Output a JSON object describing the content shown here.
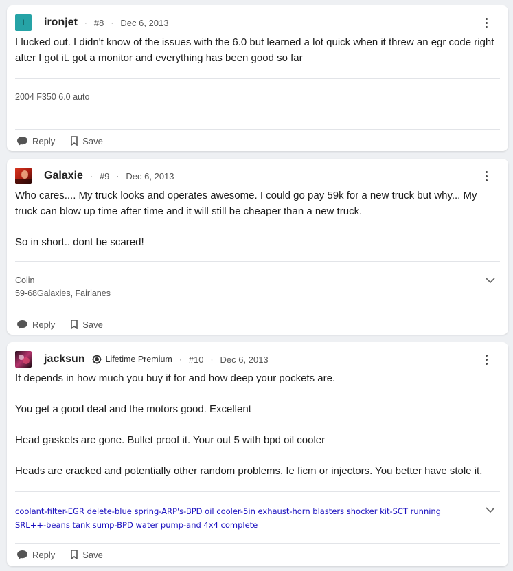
{
  "posts": [
    {
      "avatar_letter": "I",
      "avatar_color": "#26a3a6",
      "username": "ironjet",
      "badge": "",
      "number": "#8",
      "date": "Dec 6, 2013",
      "body": [
        "I lucked out. I didn't know of the issues with the 6.0 but learned a lot quick when it threw an egr code right after I got it. got a monitor and everything has been good so far"
      ],
      "signature": [
        "2004 F350 6.0 auto"
      ],
      "reply_label": "Reply",
      "save_label": "Save"
    },
    {
      "avatar_letter": "",
      "username": "Galaxie",
      "badge": "",
      "number": "#9",
      "date": "Dec 6, 2013",
      "body": [
        "Who cares.... My truck looks and operates awesome. I could go pay 59k for a new truck but why... My truck can blow up time after time and it will still be cheaper than a new truck.",
        "So in short.. dont be scared!"
      ],
      "signature": [
        "Colin",
        "59-68Galaxies, Fairlanes"
      ],
      "reply_label": "Reply",
      "save_label": "Save"
    },
    {
      "avatar_letter": "",
      "username": "jacksun",
      "badge": "Lifetime Premium",
      "number": "#10",
      "date": "Dec 6, 2013",
      "body": [
        "It depends in how much you buy it for and how deep your pockets are.",
        "You get a good deal and the motors good. Excellent",
        "Head gaskets are gone. Bullet proof it. Your out 5 with bpd oil cooler",
        "Heads are cracked and potentially other random problems. Ie ficm or injectors. You better have stole it."
      ],
      "signature": [
        "coolant-filter-EGR delete-blue spring-ARP's-BPD oil cooler-5in exhaust-horn blasters shocker kit-SCT running",
        "SRL++-beans tank sump-BPD water pump-and 4x4 complete"
      ],
      "signature_color": "#1a0fbf",
      "reply_label": "Reply",
      "save_label": "Save"
    }
  ],
  "separator": "·"
}
